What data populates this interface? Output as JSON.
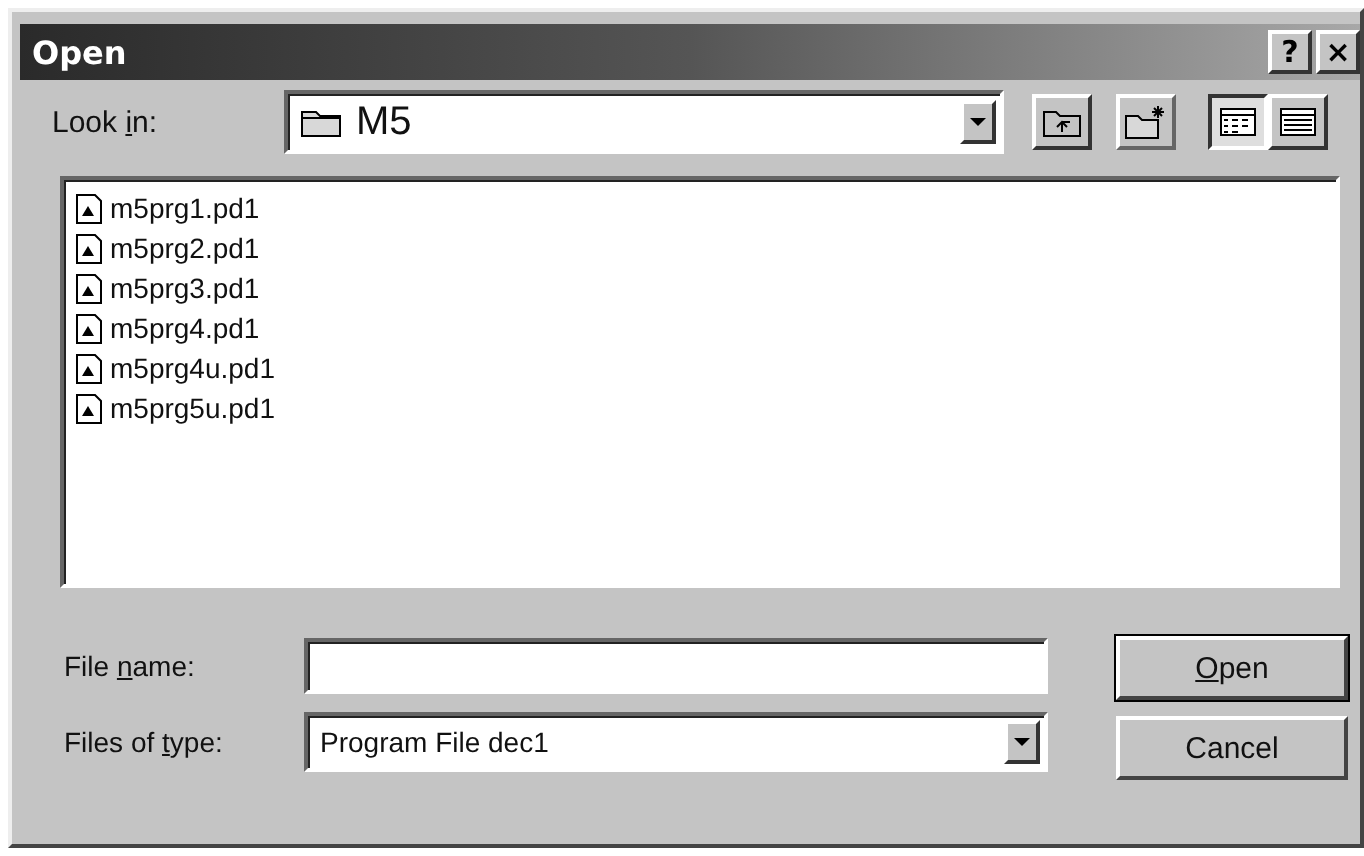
{
  "window": {
    "title": "Open",
    "title_buttons": [
      "?",
      "×"
    ]
  },
  "look_in": {
    "label": {
      "before": "Look ",
      "key": "i",
      "after": "n:"
    },
    "value": "M5"
  },
  "files": [
    {
      "name": "m5prg1.pd1"
    },
    {
      "name": "m5prg2.pd1"
    },
    {
      "name": "m5prg3.pd1"
    },
    {
      "name": "m5prg4.pd1"
    },
    {
      "name": "m5prg4u.pd1"
    },
    {
      "name": "m5prg5u.pd1"
    }
  ],
  "view_buttons": [
    {
      "kind": "list",
      "selected": true
    },
    {
      "kind": "details",
      "selected": false
    }
  ],
  "file_name": {
    "label": {
      "before": "File ",
      "key": "n",
      "after": "ame:"
    }
  },
  "file_type": {
    "label": {
      "before": "Files of ",
      "key": "t",
      "after": "ype:"
    },
    "value": "Program File dec1"
  },
  "buttons": [
    {
      "label": {
        "key": "O",
        "after": "pen"
      },
      "default": true
    },
    {
      "label": {
        "after": "Cancel"
      },
      "default": false
    }
  ]
}
